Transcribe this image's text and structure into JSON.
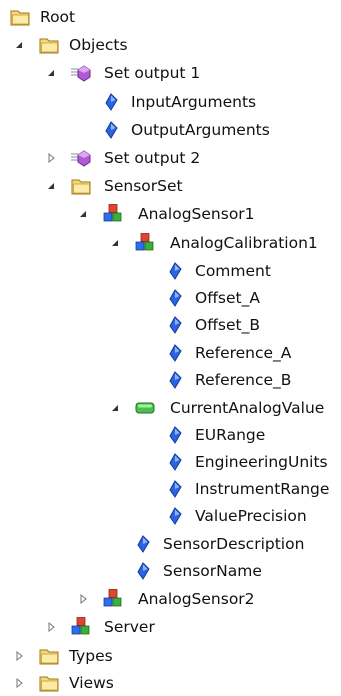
{
  "colors": {
    "folder": "#e8c252",
    "folder_edge": "#9e7a18",
    "property": "#1e5bd6",
    "method": "#a94fcf",
    "variable": "#3cb44b",
    "object_red": "#e0452c",
    "object_blue": "#2f6ee6",
    "object_green": "#3cae3c"
  },
  "tree": {
    "root": "Root",
    "objects": "Objects",
    "set_output_1": "Set output 1",
    "input_arguments": "InputArguments",
    "output_arguments": "OutputArguments",
    "set_output_2": "Set output 2",
    "sensor_set": "SensorSet",
    "analog_sensor_1": "AnalogSensor1",
    "analog_calibration_1": "AnalogCalibration1",
    "comment": "Comment",
    "offset_a": "Offset_A",
    "offset_b": "Offset_B",
    "reference_a": "Reference_A",
    "reference_b": "Reference_B",
    "current_analog_value": "CurrentAnalogValue",
    "eu_range": "EURange",
    "engineering_units": "EngineeringUnits",
    "instrument_range": "InstrumentRange",
    "value_precision": "ValuePrecision",
    "sensor_description": "SensorDescription",
    "sensor_name": "SensorName",
    "analog_sensor_2": "AnalogSensor2",
    "server": "Server",
    "types": "Types",
    "views": "Views"
  }
}
